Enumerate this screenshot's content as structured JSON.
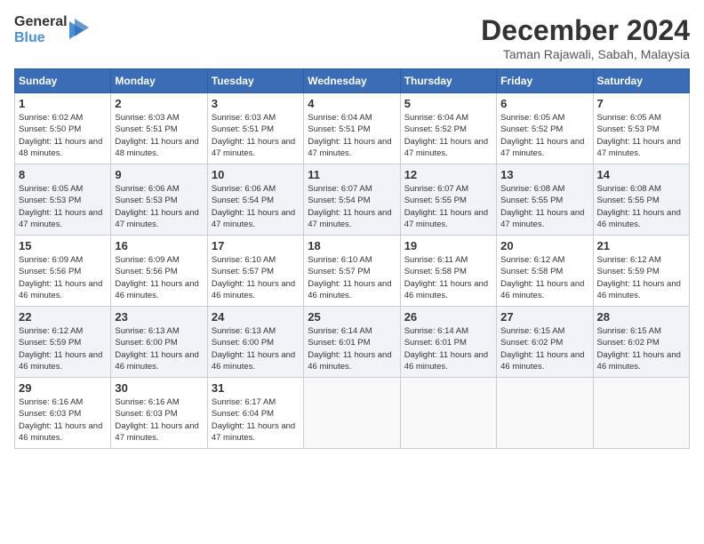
{
  "header": {
    "logo_line1": "General",
    "logo_line2": "Blue",
    "month": "December 2024",
    "location": "Taman Rajawali, Sabah, Malaysia"
  },
  "weekdays": [
    "Sunday",
    "Monday",
    "Tuesday",
    "Wednesday",
    "Thursday",
    "Friday",
    "Saturday"
  ],
  "weeks": [
    [
      {
        "day": "1",
        "sunrise": "6:02 AM",
        "sunset": "5:50 PM",
        "daylight": "11 hours and 48 minutes."
      },
      {
        "day": "2",
        "sunrise": "6:03 AM",
        "sunset": "5:51 PM",
        "daylight": "11 hours and 48 minutes."
      },
      {
        "day": "3",
        "sunrise": "6:03 AM",
        "sunset": "5:51 PM",
        "daylight": "11 hours and 47 minutes."
      },
      {
        "day": "4",
        "sunrise": "6:04 AM",
        "sunset": "5:51 PM",
        "daylight": "11 hours and 47 minutes."
      },
      {
        "day": "5",
        "sunrise": "6:04 AM",
        "sunset": "5:52 PM",
        "daylight": "11 hours and 47 minutes."
      },
      {
        "day": "6",
        "sunrise": "6:05 AM",
        "sunset": "5:52 PM",
        "daylight": "11 hours and 47 minutes."
      },
      {
        "day": "7",
        "sunrise": "6:05 AM",
        "sunset": "5:53 PM",
        "daylight": "11 hours and 47 minutes."
      }
    ],
    [
      {
        "day": "8",
        "sunrise": "6:05 AM",
        "sunset": "5:53 PM",
        "daylight": "11 hours and 47 minutes."
      },
      {
        "day": "9",
        "sunrise": "6:06 AM",
        "sunset": "5:53 PM",
        "daylight": "11 hours and 47 minutes."
      },
      {
        "day": "10",
        "sunrise": "6:06 AM",
        "sunset": "5:54 PM",
        "daylight": "11 hours and 47 minutes."
      },
      {
        "day": "11",
        "sunrise": "6:07 AM",
        "sunset": "5:54 PM",
        "daylight": "11 hours and 47 minutes."
      },
      {
        "day": "12",
        "sunrise": "6:07 AM",
        "sunset": "5:55 PM",
        "daylight": "11 hours and 47 minutes."
      },
      {
        "day": "13",
        "sunrise": "6:08 AM",
        "sunset": "5:55 PM",
        "daylight": "11 hours and 47 minutes."
      },
      {
        "day": "14",
        "sunrise": "6:08 AM",
        "sunset": "5:55 PM",
        "daylight": "11 hours and 46 minutes."
      }
    ],
    [
      {
        "day": "15",
        "sunrise": "6:09 AM",
        "sunset": "5:56 PM",
        "daylight": "11 hours and 46 minutes."
      },
      {
        "day": "16",
        "sunrise": "6:09 AM",
        "sunset": "5:56 PM",
        "daylight": "11 hours and 46 minutes."
      },
      {
        "day": "17",
        "sunrise": "6:10 AM",
        "sunset": "5:57 PM",
        "daylight": "11 hours and 46 minutes."
      },
      {
        "day": "18",
        "sunrise": "6:10 AM",
        "sunset": "5:57 PM",
        "daylight": "11 hours and 46 minutes."
      },
      {
        "day": "19",
        "sunrise": "6:11 AM",
        "sunset": "5:58 PM",
        "daylight": "11 hours and 46 minutes."
      },
      {
        "day": "20",
        "sunrise": "6:12 AM",
        "sunset": "5:58 PM",
        "daylight": "11 hours and 46 minutes."
      },
      {
        "day": "21",
        "sunrise": "6:12 AM",
        "sunset": "5:59 PM",
        "daylight": "11 hours and 46 minutes."
      }
    ],
    [
      {
        "day": "22",
        "sunrise": "6:12 AM",
        "sunset": "5:59 PM",
        "daylight": "11 hours and 46 minutes."
      },
      {
        "day": "23",
        "sunrise": "6:13 AM",
        "sunset": "6:00 PM",
        "daylight": "11 hours and 46 minutes."
      },
      {
        "day": "24",
        "sunrise": "6:13 AM",
        "sunset": "6:00 PM",
        "daylight": "11 hours and 46 minutes."
      },
      {
        "day": "25",
        "sunrise": "6:14 AM",
        "sunset": "6:01 PM",
        "daylight": "11 hours and 46 minutes."
      },
      {
        "day": "26",
        "sunrise": "6:14 AM",
        "sunset": "6:01 PM",
        "daylight": "11 hours and 46 minutes."
      },
      {
        "day": "27",
        "sunrise": "6:15 AM",
        "sunset": "6:02 PM",
        "daylight": "11 hours and 46 minutes."
      },
      {
        "day": "28",
        "sunrise": "6:15 AM",
        "sunset": "6:02 PM",
        "daylight": "11 hours and 46 minutes."
      }
    ],
    [
      {
        "day": "29",
        "sunrise": "6:16 AM",
        "sunset": "6:03 PM",
        "daylight": "11 hours and 46 minutes."
      },
      {
        "day": "30",
        "sunrise": "6:16 AM",
        "sunset": "6:03 PM",
        "daylight": "11 hours and 47 minutes."
      },
      {
        "day": "31",
        "sunrise": "6:17 AM",
        "sunset": "6:04 PM",
        "daylight": "11 hours and 47 minutes."
      },
      null,
      null,
      null,
      null
    ]
  ],
  "labels": {
    "sunrise": "Sunrise:",
    "sunset": "Sunset:",
    "daylight": "Daylight:"
  }
}
